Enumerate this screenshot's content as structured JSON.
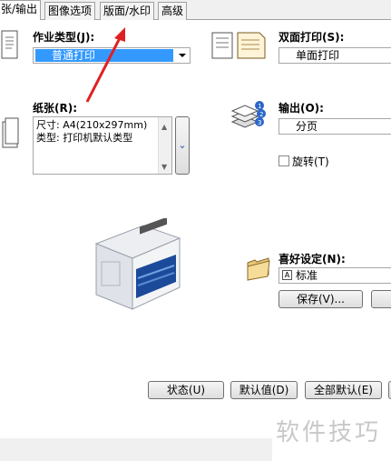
{
  "tabs": [
    {
      "label": "张/输出",
      "active": true
    },
    {
      "label": "图像选项",
      "active": false
    },
    {
      "label": "版面/水印",
      "active": false
    },
    {
      "label": "高级",
      "active": false
    }
  ],
  "job_type": {
    "label": "作业类型(J):",
    "value": "普通打印"
  },
  "duplex": {
    "label": "双面打印(S):",
    "value": "单面打印"
  },
  "paper": {
    "label": "纸张(R):",
    "lines": [
      "尺寸: A4(210x297mm)",
      "类型: 打印机默认类型"
    ]
  },
  "output": {
    "label": "输出(O):",
    "value": "分页"
  },
  "rotate": {
    "label": "旋转(T)",
    "checked": false
  },
  "favorites": {
    "label": "喜好设定(N):",
    "value": "标准",
    "save_button": "保存(V)..."
  },
  "bottom_buttons": {
    "status": "状态(U)",
    "defaults": "默认值(D)",
    "all_defaults": "全部默认(E)"
  },
  "watermark_text": "软件技巧",
  "colors": {
    "selection": "#3399ff",
    "arrow": "#e02020"
  }
}
